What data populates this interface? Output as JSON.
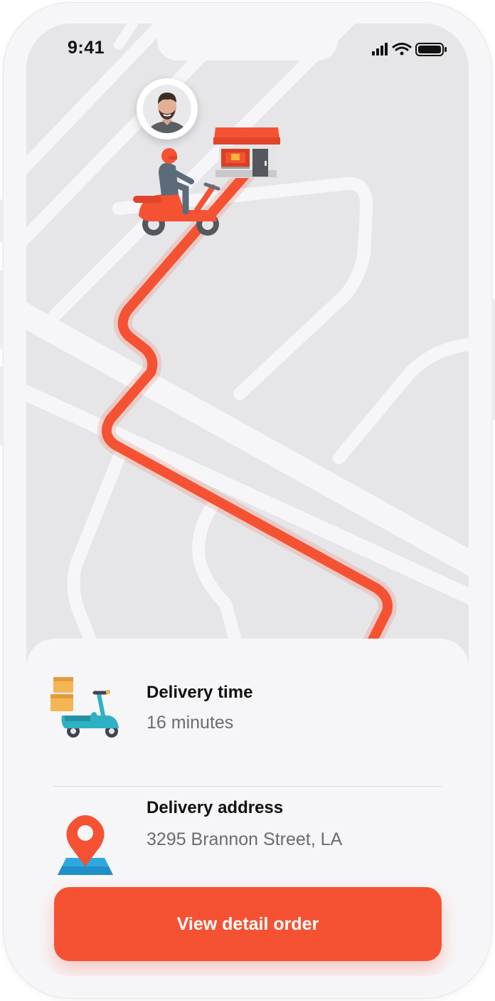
{
  "status_bar": {
    "time": "9:41"
  },
  "map": {
    "route_color": "#f55233",
    "icons": {
      "driver_avatar": "driver-avatar-icon",
      "courier": "scooter-courier-icon",
      "store": "store-icon"
    }
  },
  "delivery_time": {
    "title": "Delivery time",
    "value": "16 minutes",
    "icon": "delivery-scooter-icon"
  },
  "delivery_address": {
    "title": "Delivery address",
    "value": "3295 Brannon Street, LA",
    "icon": "map-pin-icon"
  },
  "action": {
    "label": "View detail order"
  },
  "colors": {
    "accent": "#f55233",
    "map_bg": "#e6e6e8",
    "road": "#f6f6f8",
    "sheet": "#f6f6f8"
  }
}
